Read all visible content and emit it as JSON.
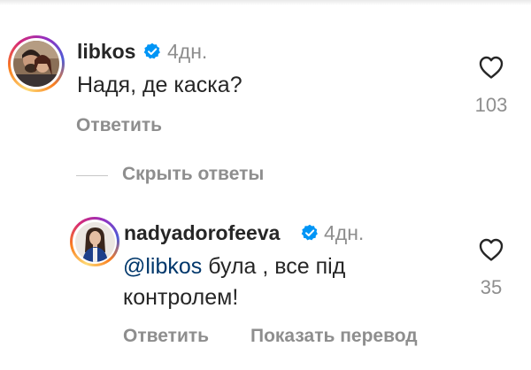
{
  "comments": [
    {
      "username": "libkos",
      "verified_icon": "verified-badge-icon",
      "time": "4дн.",
      "text": "Надя, де каска?",
      "reply_label": "Ответить",
      "likes": "103",
      "avatar_icon": "avatar-photo-icon"
    }
  ],
  "replies_toggle": {
    "label": "Скрыть ответы"
  },
  "replies": [
    {
      "username": "nadyadorofeeva",
      "verified_icon": "verified-badge-icon",
      "time": "4дн.",
      "mention": "@libkos",
      "text_after_mention": " була , все під",
      "text_line2": "контролем!",
      "reply_label": "Ответить",
      "translate_label": "Показать перевод",
      "likes": "35",
      "avatar_icon": "avatar-photo-icon"
    }
  ],
  "colors": {
    "username": "#262626",
    "secondary": "#8e8e8e",
    "mention": "#00376b",
    "verified": "#0095f6"
  }
}
